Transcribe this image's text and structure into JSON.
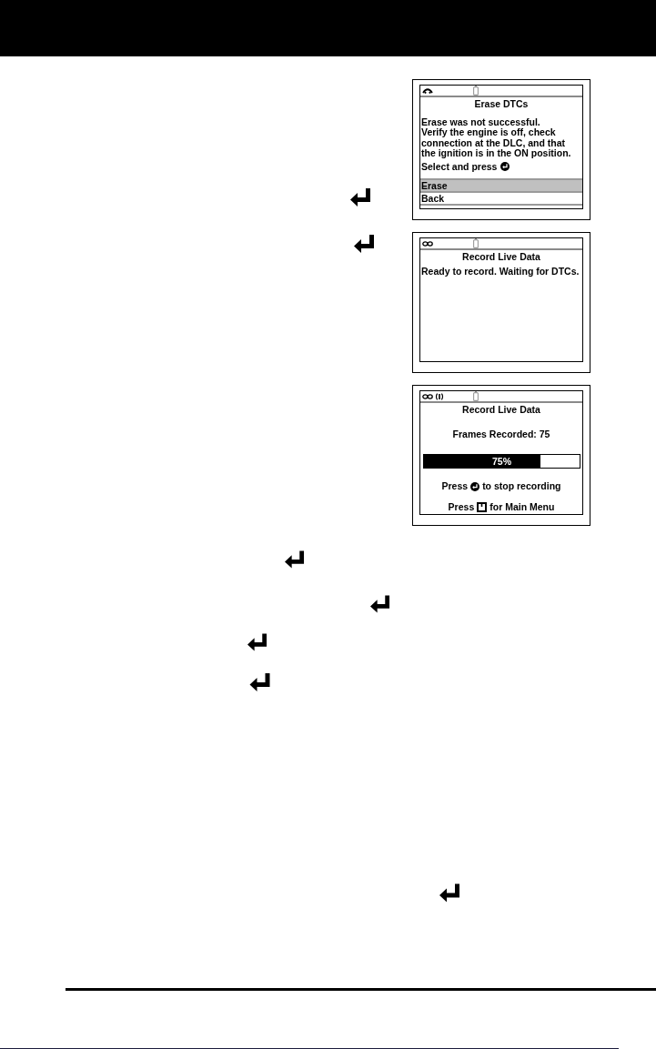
{
  "screens": [
    {
      "kind": "menu",
      "status": {
        "linked": false,
        "recording": false
      },
      "title": "Erase DTCs",
      "message": [
        "Erase was not successful.",
        "Verify the engine is off, check connection at the DLC, and that the ignition is in the ON position."
      ],
      "prompt": "Select and press",
      "options": [
        {
          "label": "Erase",
          "selected": true
        },
        {
          "label": "Back",
          "selected": false
        }
      ]
    },
    {
      "kind": "message",
      "status": {
        "linked": true,
        "recording": false
      },
      "title": "Record Live Data",
      "message": [
        "Ready to record. Waiting for DTCs."
      ]
    },
    {
      "kind": "progress",
      "status": {
        "linked": true,
        "recording": true
      },
      "title": "Record Live Data",
      "counter": "Frames Recorded: 75",
      "progress": {
        "level": 0.75,
        "reading": "75%"
      },
      "instructions": [
        {
          "kind": "enter",
          "before": "Press",
          "after": "to stop recording"
        },
        {
          "kind": "menu",
          "before": "Press",
          "after": "for Main Menu"
        }
      ]
    }
  ]
}
